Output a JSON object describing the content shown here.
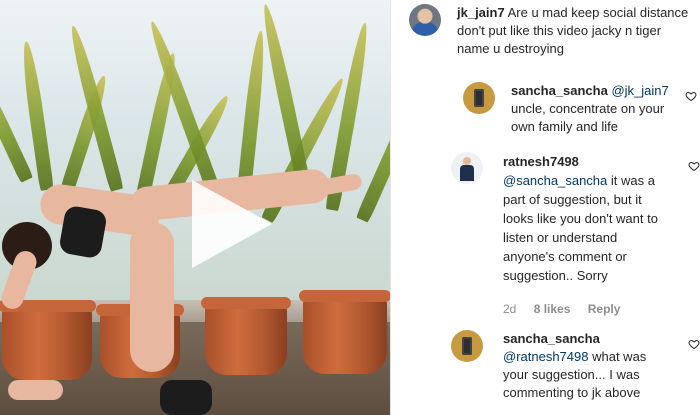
{
  "comments": [
    {
      "username": "jk_jain7",
      "text": "Are u mad keep social distance don't put like this video jacky n tiger name u destroying"
    },
    {
      "username": "sancha_sancha",
      "mention": "@jk_jain7",
      "text": "uncle, concentrate on your own family and life"
    },
    {
      "username": "ratnesh7498",
      "mention": "@sancha_sancha",
      "text": "it was a part of suggestion, but it looks like you don't want to listen or understand anyone's comment or suggestion.. Sorry",
      "age": "2d",
      "likes": "8 likes",
      "reply_label": "Reply"
    },
    {
      "username": "sancha_sancha",
      "mention": "@ratnesh7498",
      "text": "what was your suggestion... I was commenting to jk above"
    }
  ],
  "icons": {
    "heart": "heart-outline-icon",
    "play": "play-icon"
  },
  "colors": {
    "text": "#262626",
    "mention": "#00376b",
    "meta": "#8e8e8e"
  }
}
